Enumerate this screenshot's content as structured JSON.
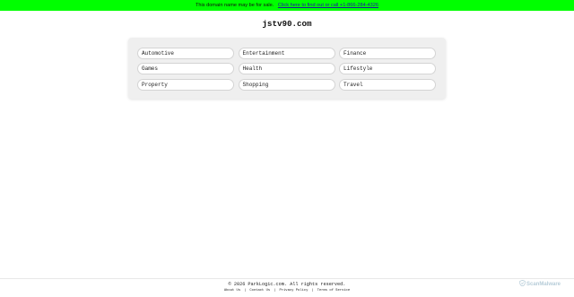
{
  "banner": {
    "message": "This domain name may be for sale.",
    "link_text": "Click here to find out or call +1-866-284-4326",
    "background_color": "#00ff00"
  },
  "page": {
    "title": "jstv90.com"
  },
  "categories": [
    {
      "label": "Automotive"
    },
    {
      "label": "Entertainment"
    },
    {
      "label": "Finance"
    },
    {
      "label": "Games"
    },
    {
      "label": "Health"
    },
    {
      "label": "Lifestyle"
    },
    {
      "label": "Property"
    },
    {
      "label": "Shopping"
    },
    {
      "label": "Travel"
    }
  ],
  "footer": {
    "copyright": "© 2026 ParkLogic.com. All rights reserved.",
    "links": [
      {
        "label": "About Us"
      },
      {
        "label": "Contact Us"
      },
      {
        "label": "Privacy Policy"
      },
      {
        "label": "Terms of Service"
      }
    ],
    "separator": "|"
  },
  "badge": {
    "text": "ScanMalware",
    "icon": "shield-check-icon"
  }
}
